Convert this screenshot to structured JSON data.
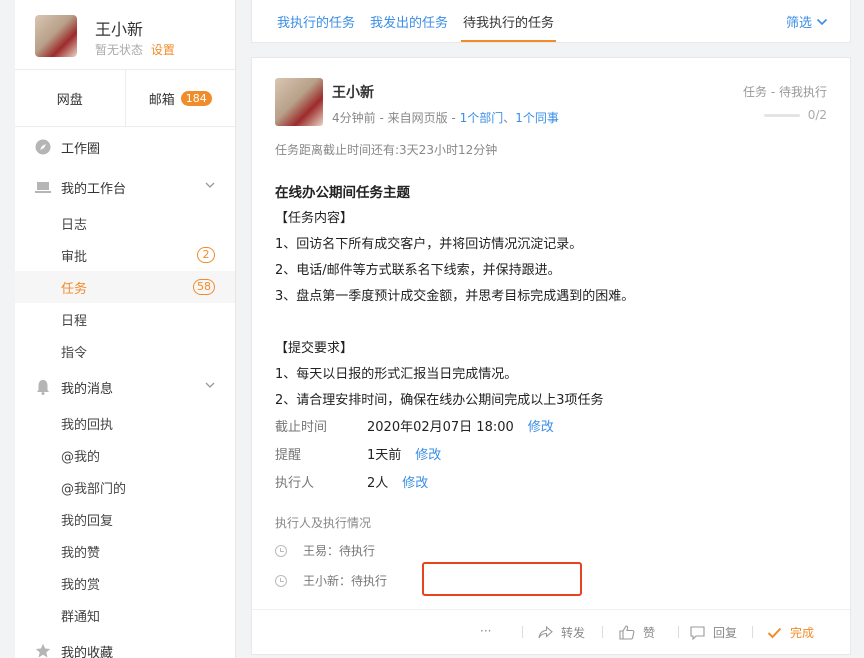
{
  "user": {
    "name": "王小新",
    "status": "暂无状态",
    "settings_link": "设置"
  },
  "quick_tabs": {
    "netdisk": "网盘",
    "mailbox": "邮箱",
    "mailbox_count": "184"
  },
  "nav": {
    "work_circle": "工作圈",
    "workbench": "我的工作台",
    "workbench_items": [
      {
        "label": "日志",
        "count": ""
      },
      {
        "label": "审批",
        "count": "2"
      },
      {
        "label": "任务",
        "count": "58"
      },
      {
        "label": "日程",
        "count": ""
      },
      {
        "label": "指令",
        "count": ""
      }
    ],
    "messages": "我的消息",
    "message_items": [
      "我的回执",
      "@我的",
      "@我部门的",
      "我的回复",
      "我的赞",
      "我的赏",
      "群通知"
    ],
    "favorites": "我的收藏"
  },
  "top_tabs": [
    "我执行的任务",
    "我发出的任务",
    "待我执行的任务"
  ],
  "filter": "筛选",
  "task": {
    "author": "王小新",
    "meta_prefix": "4分钟前 - 来自网页版 - ",
    "dept_link": "1个部门",
    "meta_sep": "、",
    "colleague_link": "1个同事",
    "type": "任务 - 待我执行",
    "progress": "0/2",
    "deadline_note": "任务距离截止时间还有:3天23小时12分钟",
    "title": "在线办公期间任务主题",
    "section1": "【任务内容】",
    "items1": [
      "1、回访名下所有成交客户，并将回访情况沉淀记录。",
      "2、电话/邮件等方式联系名下线索，并保持跟进。",
      "3、盘点第一季度预计成交金额，并思考目标完成遇到的困难。"
    ],
    "section2": "【提交要求】",
    "items2": [
      "1、每天以日报的形式汇报当日完成情况。",
      "2、请合理安排时间，确保在线办公期间完成以上3项任务"
    ],
    "fields": [
      {
        "label": "截止时间",
        "value": "2020年02月07日 18:00",
        "action": "修改"
      },
      {
        "label": "提醒",
        "value": "1天前",
        "action": "修改"
      },
      {
        "label": "执行人",
        "value": "2人",
        "action": "修改"
      }
    ],
    "exec_title": "执行人及执行情况",
    "executors": [
      "王易：待执行",
      "王小新：待执行"
    ]
  },
  "actions": {
    "more": "···",
    "forward": "转发",
    "like": "赞",
    "reply": "回复",
    "complete": "完成"
  },
  "colors": {
    "accent": "#f08c2a",
    "link": "#3a8ee6",
    "highlight": "#e8431e"
  }
}
